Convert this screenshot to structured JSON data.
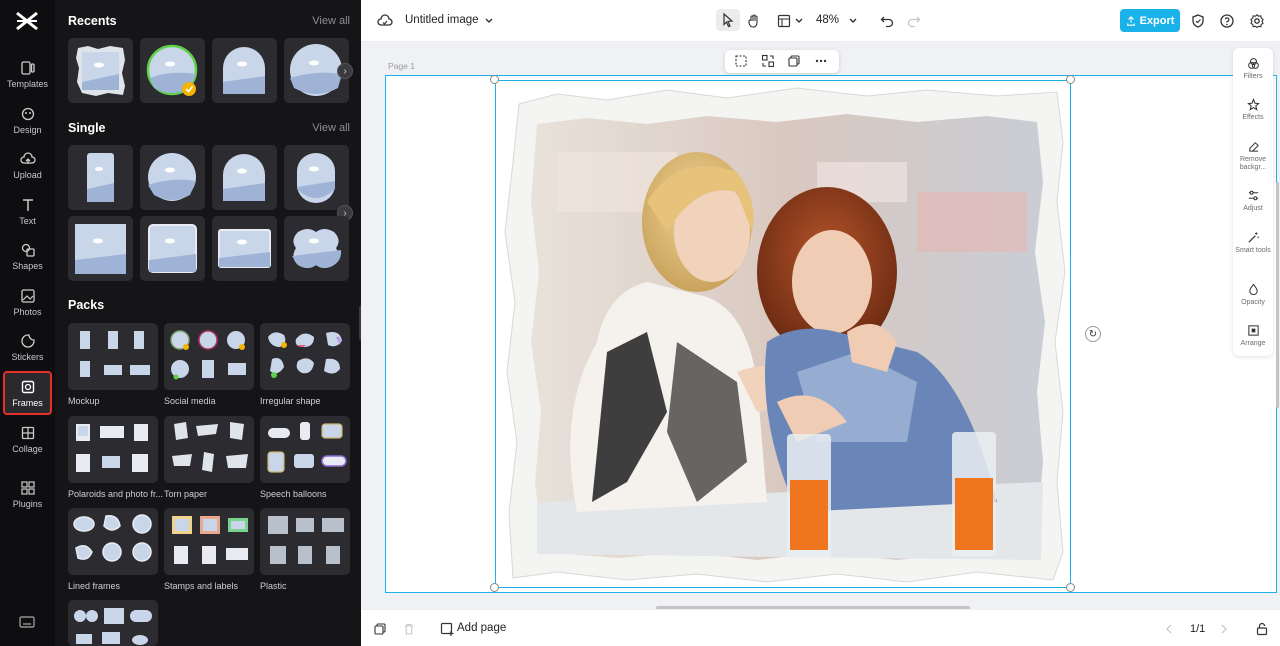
{
  "app": {
    "title": "Untitled image",
    "zoom": "48%",
    "export_label": "Export"
  },
  "rail": {
    "items": [
      {
        "label": "Templates",
        "icon": "templates-icon"
      },
      {
        "label": "Design",
        "icon": "design-icon"
      },
      {
        "label": "Upload",
        "icon": "upload-icon"
      },
      {
        "label": "Text",
        "icon": "text-icon"
      },
      {
        "label": "Shapes",
        "icon": "shapes-icon"
      },
      {
        "label": "Photos",
        "icon": "photos-icon"
      },
      {
        "label": "Stickers",
        "icon": "stickers-icon"
      },
      {
        "label": "Frames",
        "icon": "frames-icon",
        "active": true
      },
      {
        "label": "Collage",
        "icon": "collage-icon"
      },
      {
        "label": "Plugins",
        "icon": "plugins-icon"
      }
    ]
  },
  "panel": {
    "recents_title": "Recents",
    "single_title": "Single",
    "packs_title": "Packs",
    "view_all": "View all",
    "packs": [
      {
        "label": "Mockup"
      },
      {
        "label": "Social media"
      },
      {
        "label": "Irregular shape"
      },
      {
        "label": "Polaroids and photo fr..."
      },
      {
        "label": "Torn paper"
      },
      {
        "label": "Speech balloons"
      },
      {
        "label": "Lined frames"
      },
      {
        "label": "Stamps and labels"
      },
      {
        "label": "Plastic"
      }
    ]
  },
  "canvas": {
    "page_label": "Page 1"
  },
  "right_tools": [
    {
      "label": "Filters"
    },
    {
      "label": "Effects"
    },
    {
      "label": "Remove backgr..."
    },
    {
      "label": "Adjust"
    },
    {
      "label": "Smart tools"
    },
    {
      "label": "Opacity"
    },
    {
      "label": "Arrange"
    }
  ],
  "bottom": {
    "add_page": "Add page",
    "pager": "1/1"
  },
  "colors": {
    "accent": "#19b3ea",
    "panel_bg": "#151518",
    "rail_bg": "#0e0e10",
    "active_border": "#e5302a"
  }
}
